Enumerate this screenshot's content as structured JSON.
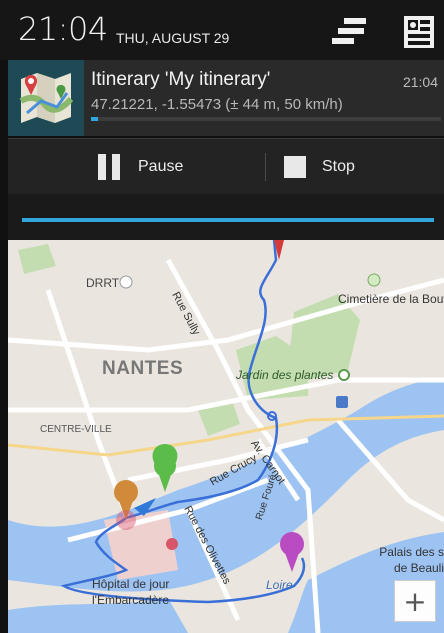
{
  "status_bar": {
    "time": "21:04",
    "date": "THU, AUGUST 29"
  },
  "notification": {
    "title": "Itinerary 'My itinerary'",
    "time": "21:04",
    "subtitle": "47.21221, -1.55473 (± 44 m, 50 km/h)",
    "progress_fraction": 0.02,
    "icon": "map-icon",
    "actions": [
      {
        "label": "Pause",
        "icon": "pause-icon"
      },
      {
        "label": "Stop",
        "icon": "stop-icon"
      }
    ]
  },
  "map": {
    "labels": {
      "city": "NANTES",
      "drrt": "DRRT",
      "cimetiere": "Cimetière de la Bouteillerie",
      "jardin": "Jardin des plantes",
      "centre": "CENTRE-VILLE",
      "rue_sully": "Rue Sully",
      "rue_crucy": "Rue Crucy",
      "av_carnot": "Av. Carnot",
      "rue_olivettes": "Rue des Olivettes",
      "rue_foure": "Rue Fouré",
      "loire": "Loire",
      "palais": "Palais des s de Beauli",
      "hopital": "Hôpital de jour l'Embarcadère"
    },
    "zoom_in_label": "+"
  },
  "colors": {
    "accent": "#32a6dc",
    "route": "#3a6fd8",
    "water": "#9dc3f2",
    "park": "#c4ddb0",
    "marker_green": "#5cbc4a",
    "marker_orange": "#d08a3a",
    "marker_purple": "#b84cc0",
    "marker_red": "#d43a3a"
  }
}
